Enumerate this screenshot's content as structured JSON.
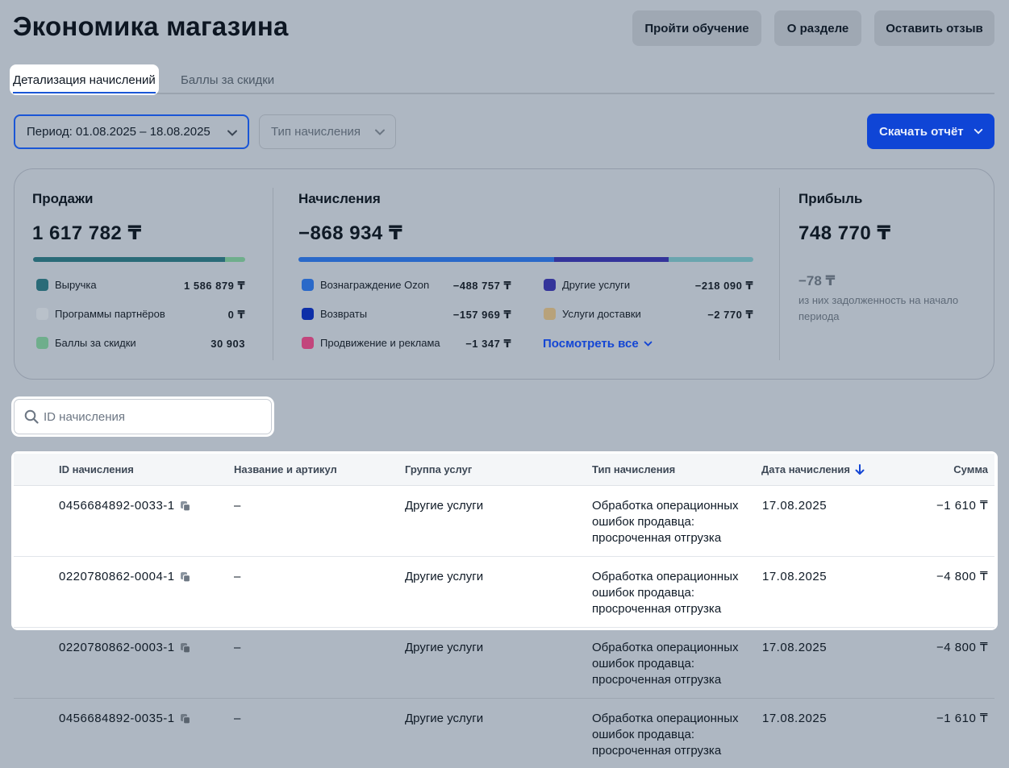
{
  "page": {
    "title": "Экономика магазина",
    "header_buttons": [
      "Пройти обучение",
      "О разделе",
      "Оставить отзыв"
    ]
  },
  "tabs": [
    {
      "label": "Детализация начислений",
      "active": true
    },
    {
      "label": "Баллы за скидки",
      "active": false
    }
  ],
  "filters": {
    "period_label": "Период: 01.08.2025 – 18.08.2025",
    "type_label": "Тип начисления",
    "download_label": "Скачать отчёт"
  },
  "summary": {
    "sales": {
      "title": "Продажи",
      "value": "1 617 782 ₸",
      "bar": [
        {
          "color": "#2a6b78",
          "fraction": 0.906
        },
        {
          "color": "#6fae8c",
          "fraction": 0.094
        }
      ],
      "legend": [
        {
          "label": "Выручка",
          "value": "1 586 879 ₸",
          "color": "#2a6b78"
        },
        {
          "label": "Программы партнёров",
          "value": "0 ₸",
          "color": "#b9c1ca"
        },
        {
          "label": "Баллы за скидки",
          "value": "30 903",
          "color": "#6fae8c"
        }
      ]
    },
    "charges": {
      "title": "Начисления",
      "value": "−868 934 ₸",
      "bar": [
        {
          "color": "#2a69c9",
          "fraction": 0.562
        },
        {
          "color": "#34349a",
          "fraction": 0.251
        },
        {
          "color": "#6aa5ae",
          "fraction": 0.187
        }
      ],
      "legend_left": [
        {
          "label": "Вознаграждение Ozon",
          "value": "−488 757 ₸",
          "color": "#2a69c9"
        },
        {
          "label": "Возвраты",
          "value": "−157 969 ₸",
          "color": "#0e2fa8"
        },
        {
          "label": "Продвижение и реклама",
          "value": "−1 347 ₸",
          "color": "#c2457c"
        }
      ],
      "legend_right": [
        {
          "label": "Другие услуги",
          "value": "−218 090 ₸",
          "color": "#34349a"
        },
        {
          "label": "Услуги доставки",
          "value": "−2 770 ₸",
          "color": "#b8a27a"
        }
      ],
      "see_all": "Посмотреть все"
    },
    "profit": {
      "title": "Прибыль",
      "value": "748 770 ₸",
      "debt_value": "−78 ₸",
      "debt_note": "из них задолженность на начало периода"
    }
  },
  "search": {
    "placeholder": "ID начисления"
  },
  "table": {
    "headers": {
      "id": "ID начисления",
      "name": "Название и артикул",
      "group": "Группа услуг",
      "type": "Тип начисления",
      "date": "Дата начисления",
      "sum": "Сумма"
    },
    "rows": [
      {
        "id": "0456684892-0033-1",
        "name": "–",
        "group": "Другие услуги",
        "type": "Обработка операционных ошибок продавца: просроченная отгрузка",
        "date": "17.08.2025",
        "sum": "−1 610 ₸"
      },
      {
        "id": "0220780862-0004-1",
        "name": "–",
        "group": "Другие услуги",
        "type": "Обработка операционных ошибок продавца: просроченная отгрузка",
        "date": "17.08.2025",
        "sum": "−4 800 ₸"
      },
      {
        "id": "0220780862-0003-1",
        "name": "–",
        "group": "Другие услуги",
        "type": "Обработка операционных ошибок продавца: просроченная отгрузка",
        "date": "17.08.2025",
        "sum": "−4 800 ₸"
      },
      {
        "id": "0456684892-0035-1",
        "name": "–",
        "group": "Другие услуги",
        "type": "Обработка операционных ошибок продавца: просроченная отгрузка",
        "date": "17.08.2025",
        "sum": "−1 610 ₸"
      }
    ]
  }
}
